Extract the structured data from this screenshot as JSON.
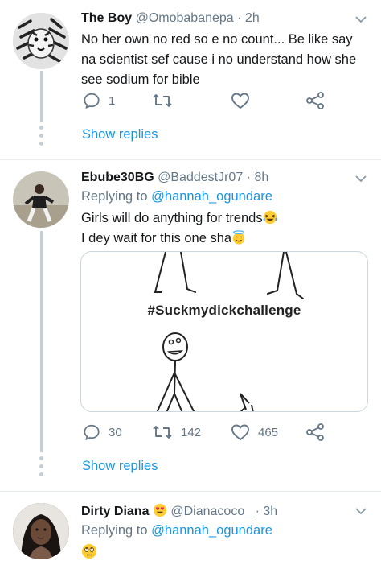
{
  "tweets": [
    {
      "name": "The Boy",
      "handle": "@Omobabanepa",
      "time": "· 2h",
      "text": "No her own no red so e no count... Be like say na scientist sef cause i no understand how she see sodium for bible",
      "actions": {
        "reply_count": "1",
        "retweet_count": "",
        "like_count": ""
      },
      "show_replies": "Show replies"
    },
    {
      "name": "Ebube30BG",
      "handle": "@BaddestJr07",
      "time": "· 8h",
      "replying_prefix": "Replying to",
      "replying_to": "@hannah_ogundare",
      "text_line1": "Girls will do anything for trends",
      "text_line2": "I dey wait for this one sha",
      "media_caption": "#Suckmydickchallenge",
      "actions": {
        "reply_count": "30",
        "retweet_count": "142",
        "like_count": "465"
      },
      "show_replies": "Show replies"
    },
    {
      "name": "Dirty Diana",
      "handle": "@Dianacoco_",
      "time": "· 3h",
      "replying_prefix": "Replying to",
      "replying_to": "@hannah_ogundare"
    }
  ],
  "icons": {
    "reply": "reply-icon",
    "retweet": "retweet-icon",
    "like": "heart-icon",
    "share": "share-icon",
    "caret": "chevron-down-icon"
  },
  "colors": {
    "link": "#1b95e0",
    "muted": "#657786",
    "thread": "#c4ced6",
    "divider": "#e6ecf0"
  }
}
